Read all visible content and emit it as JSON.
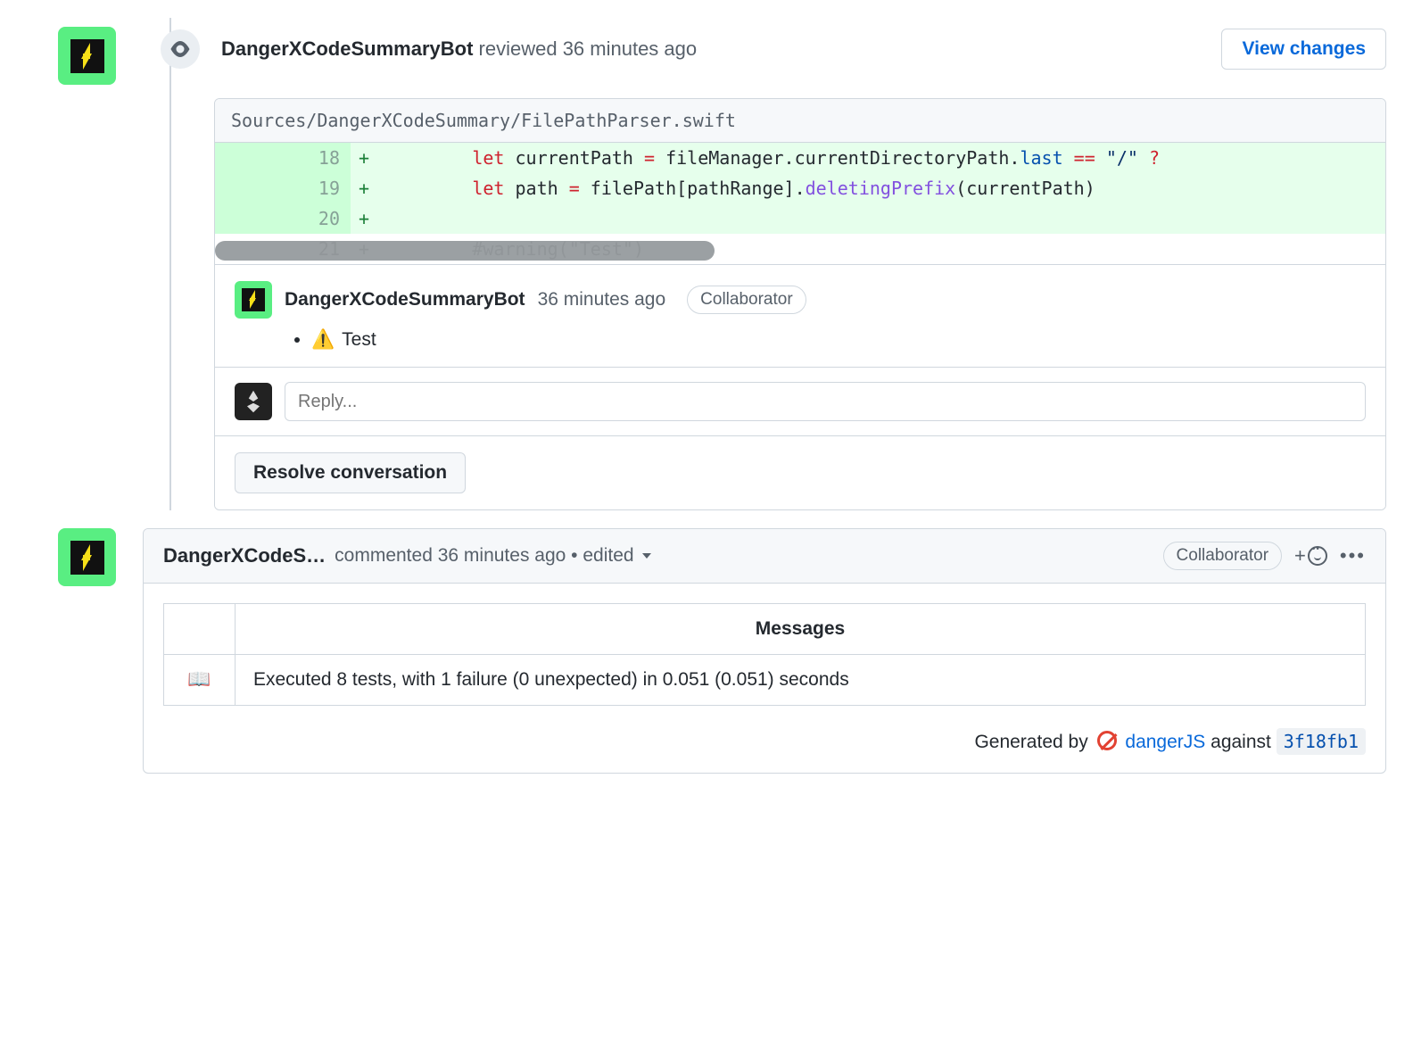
{
  "review": {
    "author": "DangerXCodeSummaryBot",
    "action": "reviewed",
    "time": "36 minutes ago",
    "view_changes": "View changes",
    "file_path": "Sources/DangerXCodeSummary/FilePathParser.swift",
    "diff": [
      {
        "old": "",
        "new": "18",
        "marker": "+",
        "tokens": [
          {
            "t": "        ",
            "c": ""
          },
          {
            "t": "let",
            "c": "kw"
          },
          {
            "t": " currentPath ",
            "c": ""
          },
          {
            "t": "=",
            "c": "op"
          },
          {
            "t": " fileManager.currentDirectoryPath.",
            "c": ""
          },
          {
            "t": "last",
            "c": "prop"
          },
          {
            "t": " ",
            "c": ""
          },
          {
            "t": "==",
            "c": "op"
          },
          {
            "t": " ",
            "c": ""
          },
          {
            "t": "\"/\"",
            "c": "str"
          },
          {
            "t": " ",
            "c": ""
          },
          {
            "t": "?",
            "c": "op"
          }
        ]
      },
      {
        "old": "",
        "new": "19",
        "marker": "+",
        "tokens": [
          {
            "t": "        ",
            "c": ""
          },
          {
            "t": "let",
            "c": "kw"
          },
          {
            "t": " path ",
            "c": ""
          },
          {
            "t": "=",
            "c": "op"
          },
          {
            "t": " filePath[pathRange].",
            "c": ""
          },
          {
            "t": "deletingPrefix",
            "c": "fn"
          },
          {
            "t": "(currentPath)",
            "c": ""
          }
        ]
      },
      {
        "old": "",
        "new": "20",
        "marker": "+",
        "tokens": []
      },
      {
        "old": "",
        "new": "21",
        "marker": "+",
        "context": true,
        "tokens": [
          {
            "t": "        ",
            "c": ""
          },
          {
            "t": "#warning",
            "c": "warn"
          },
          {
            "t": "(",
            "c": ""
          },
          {
            "t": "\"Test\"",
            "c": "warn"
          },
          {
            "t": ")",
            "c": ""
          }
        ]
      }
    ],
    "comment": {
      "author": "DangerXCodeSummaryBot",
      "time": "36 minutes ago",
      "badge": "Collaborator",
      "warning_emoji": "⚠️",
      "text": "Test"
    },
    "reply_placeholder": "Reply...",
    "resolve_label": "Resolve conversation"
  },
  "comment": {
    "author_short": "DangerXCodeS…",
    "action": "commented",
    "time": "36 minutes ago",
    "edited": "edited",
    "badge": "Collaborator",
    "table": {
      "header_icon": "",
      "header_label": "Messages",
      "row_icon": "📖",
      "row_text": "Executed 8 tests, with 1 failure (0 unexpected) in 0.051 (0.051) seconds"
    },
    "generated_prefix": "Generated by",
    "danger_label": "dangerJS",
    "against": "against",
    "sha": "3f18fb1"
  }
}
